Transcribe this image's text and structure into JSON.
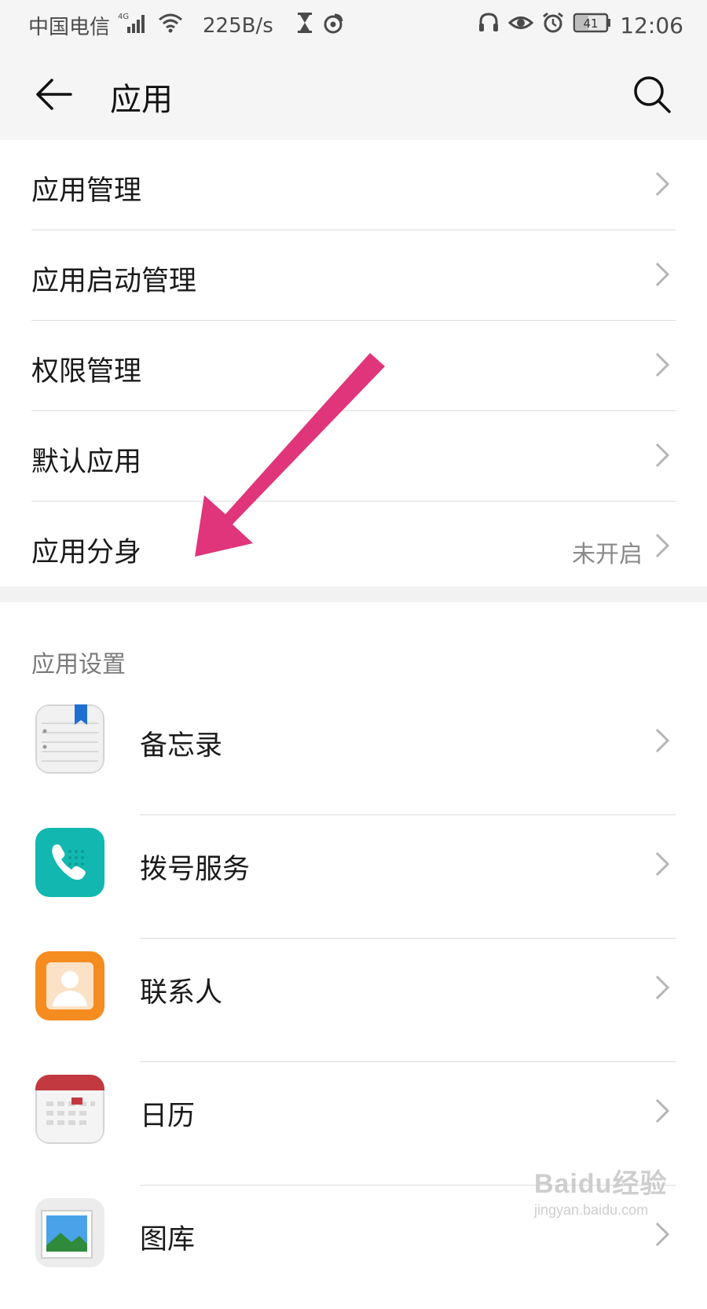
{
  "status_bar": {
    "carrier": "中国电信",
    "network_type": "4G",
    "speed": "225B/s",
    "battery": "41",
    "time": "12:06",
    "icons": [
      "signal-icon",
      "wifi-icon",
      "hourglass-icon",
      "weibo-icon",
      "headset-icon",
      "eye-icon",
      "alarm-icon",
      "battery-icon"
    ]
  },
  "toolbar": {
    "title": "应用",
    "back_icon": "back-arrow-icon",
    "search_icon": "search-icon"
  },
  "menu": {
    "items": [
      {
        "label": "应用管理",
        "value": ""
      },
      {
        "label": "应用启动管理",
        "value": ""
      },
      {
        "label": "权限管理",
        "value": ""
      },
      {
        "label": "默认应用",
        "value": ""
      },
      {
        "label": "应用分身",
        "value": "未开启"
      }
    ]
  },
  "app_settings": {
    "header": "应用设置",
    "apps": [
      {
        "label": "备忘录",
        "icon": "notepad-icon"
      },
      {
        "label": "拨号服务",
        "icon": "phone-icon"
      },
      {
        "label": "联系人",
        "icon": "contacts-icon"
      },
      {
        "label": "日历",
        "icon": "calendar-icon"
      },
      {
        "label": "图库",
        "icon": "gallery-icon"
      }
    ]
  },
  "annotation": {
    "arrow_color": "#e0357a"
  },
  "watermark": {
    "main": "Baidu经验",
    "sub": "jingyan.baidu.com"
  },
  "colors": {
    "toolbar_bg": "#f5f5f5",
    "divider": "#dcdcdc",
    "secondary_text": "#8a8a8a"
  }
}
